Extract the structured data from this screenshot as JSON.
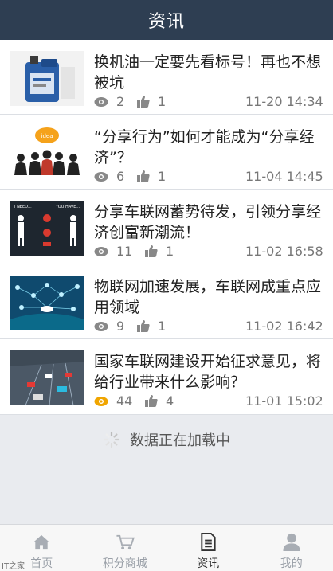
{
  "header": {
    "title": "资讯"
  },
  "news": [
    {
      "title": "换机油一定要先看标号！再也不想被坑",
      "views": "2",
      "likes": "1",
      "time": "11-20 14:34",
      "icon_color": "#888"
    },
    {
      "title": "“分享行为”如何才能成为“分享经济”？",
      "views": "6",
      "likes": "1",
      "time": "11-04 14:45",
      "icon_color": "#888"
    },
    {
      "title": "分享车联网蓄势待发，引领分享经济创富新潮流！",
      "views": "11",
      "likes": "1",
      "time": "11-02 16:58",
      "icon_color": "#888"
    },
    {
      "title": "物联网加速发展，车联网成重点应用领域",
      "views": "9",
      "likes": "1",
      "time": "11-02 16:42",
      "icon_color": "#888"
    },
    {
      "title": "国家车联网建设开始征求意见，将给行业带来什么影响？",
      "views": "44",
      "likes": "4",
      "time": "11-01 15:02",
      "icon_color": "#f0a500"
    }
  ],
  "loading": {
    "text": "数据正在加载中"
  },
  "tabbar": [
    {
      "label": "首页",
      "icon": "home-icon"
    },
    {
      "label": "积分商城",
      "icon": "cart-icon"
    },
    {
      "label": "资讯",
      "icon": "document-icon"
    },
    {
      "label": "我的",
      "icon": "person-icon"
    }
  ],
  "watermark": {
    "text": "IT之家"
  },
  "thumb_texts": {
    "idea": "idea",
    "need": "I NEED...",
    "you_have": "YOU HAVE..."
  },
  "colors": {
    "header_bg": "#2e3e52",
    "active_tab": "#333333",
    "inactive_tab": "#9aa0a8"
  }
}
